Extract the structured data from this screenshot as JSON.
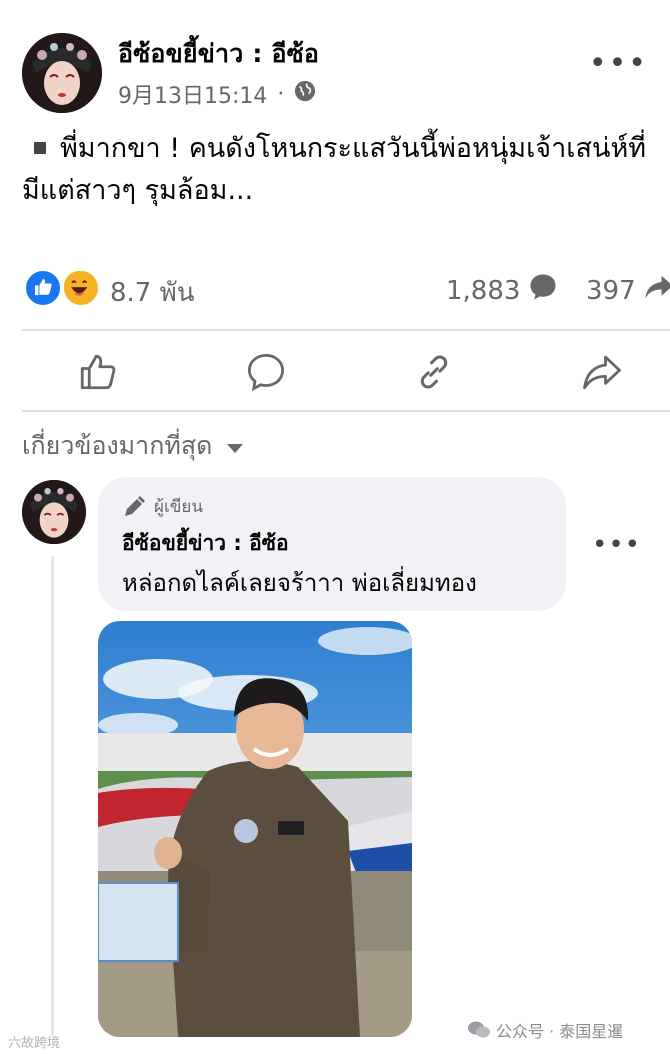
{
  "post": {
    "author": "อีซ้อขยี้ข่าว : อีซ้อ",
    "timestamp": "9月13日15:14",
    "separator": "·",
    "visibility_icon": "globe-icon",
    "more_icon": "more-icon",
    "more_label": "•••",
    "body_line1": "พี่มากขา ! คนดังโหนกระแสวันนี้พ่อหนุ่มเจ้าเสน่ห์ที่",
    "body_line2": "มีแต่สาวๆ รุมล้อม..."
  },
  "stats": {
    "reaction_icons": [
      "like-icon",
      "haha-icon"
    ],
    "reactions": "8.7 พัน",
    "comments": "1,883",
    "shares": "397"
  },
  "actions": {
    "icons": [
      "thumbs-up-icon",
      "comment-icon",
      "link-icon",
      "share-icon"
    ]
  },
  "filter": {
    "label": "เกี่ยวข้องมากที่สุด"
  },
  "comment": {
    "badge_icon": "pen-icon",
    "badge": "ผู้เขียน",
    "author": "อีซ้อขยี้ข่าว : อีซ้อ",
    "text": "หล่อกดไลค์เลยจร้าาา พ่อเลี่ยมทอง",
    "more_label": "•••"
  },
  "watermark": {
    "left": "六故跨境",
    "right": "公众号 · 泰国星暹"
  },
  "colors": {
    "facebook_blue": "#1877f2",
    "haha_yellow": "#f7b125",
    "secondary_text": "#65676b",
    "bubble_bg": "#f0f2f5"
  }
}
